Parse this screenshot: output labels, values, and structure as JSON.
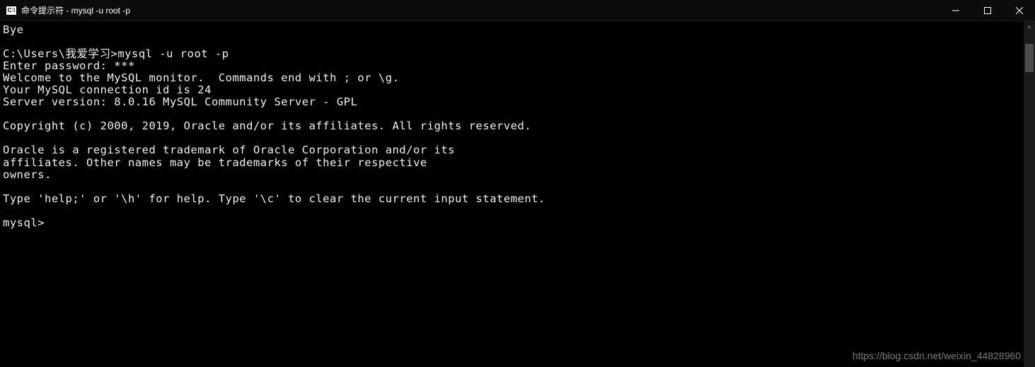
{
  "window": {
    "title": "命令提示符 - mysql  -u root -p"
  },
  "terminal": {
    "lines": {
      "bye": "Bye",
      "blank1": "",
      "prompt_cmd": "C:\\Users\\我爱学习>mysql -u root -p",
      "enter_pass": "Enter password: ***",
      "welcome": "Welcome to the MySQL monitor.  Commands end with ; or \\g.",
      "conn_id": "Your MySQL connection id is 24",
      "server_ver": "Server version: 8.0.16 MySQL Community Server - GPL",
      "blank2": "",
      "copyright": "Copyright (c) 2000, 2019, Oracle and/or its affiliates. All rights reserved.",
      "blank3": "",
      "oracle1": "Oracle is a registered trademark of Oracle Corporation and/or its",
      "oracle2": "affiliates. Other names may be trademarks of their respective",
      "oracle3": "owners.",
      "blank4": "",
      "help": "Type 'help;' or '\\h' for help. Type '\\c' to clear the current input statement.",
      "blank5": "",
      "mysql_prompt": "mysql>"
    }
  },
  "watermark": "https://blog.csdn.net/weixin_44828960"
}
